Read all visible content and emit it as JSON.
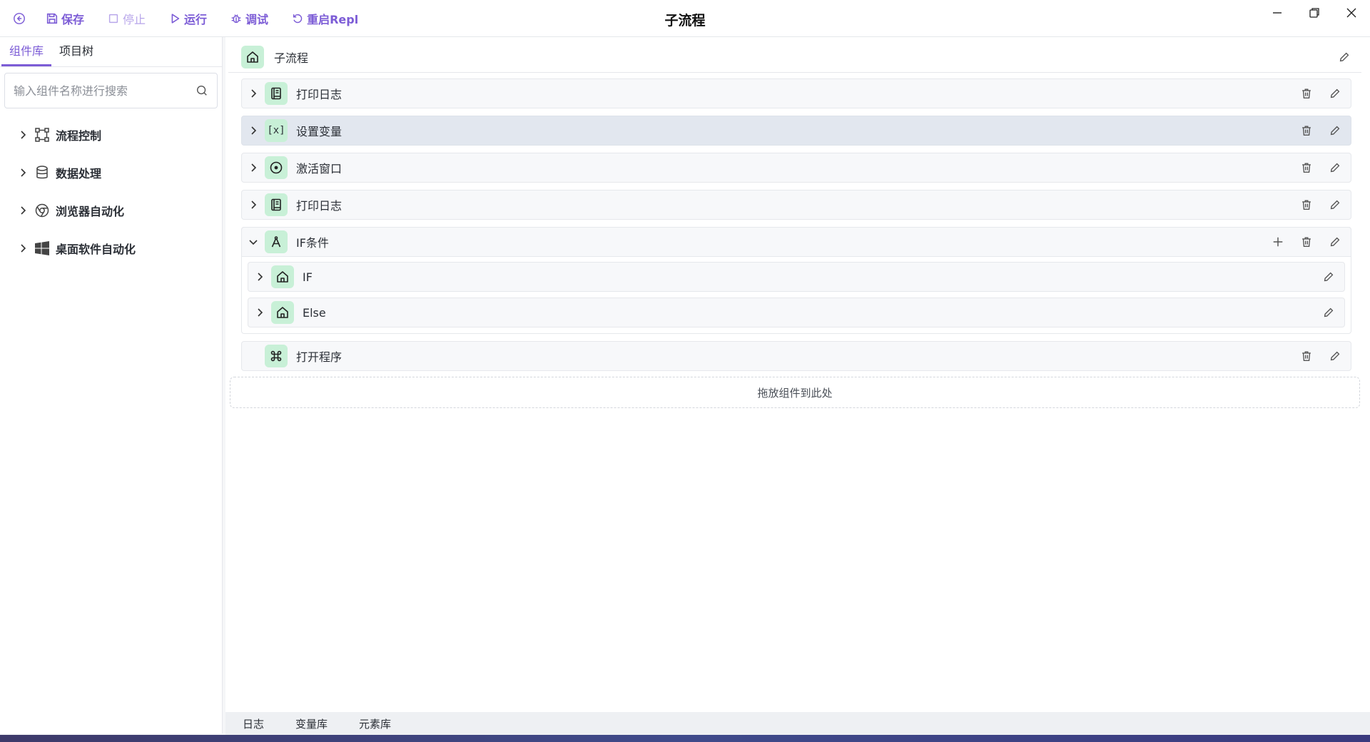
{
  "window": {
    "title": "子流程"
  },
  "toolbar": {
    "save": "保存",
    "stop": "停止",
    "run": "运行",
    "debug": "调试",
    "restart": "重启Repl"
  },
  "sidebar": {
    "tabs": [
      "组件库",
      "项目树"
    ],
    "search_placeholder": "输入组件名称进行搜索",
    "categories": [
      {
        "label": "流程控制",
        "icon": "flow-control-icon"
      },
      {
        "label": "数据处理",
        "icon": "database-icon"
      },
      {
        "label": "浏览器自动化",
        "icon": "chrome-icon"
      },
      {
        "label": "桌面软件自动化",
        "icon": "windows-icon"
      }
    ]
  },
  "flow": {
    "header_label": "子流程",
    "nodes": [
      {
        "label": "打印日志",
        "icon": "log-book-icon"
      },
      {
        "label": "设置变量",
        "icon": "variable-x-icon",
        "icon_text": "[x]"
      },
      {
        "label": "激活窗口",
        "icon": "target-circle-icon"
      },
      {
        "label": "打印日志",
        "icon": "log-book-icon"
      },
      {
        "label": "IF条件",
        "icon": "compass-icon"
      },
      {
        "label": "IF",
        "icon": "home-icon"
      },
      {
        "label": "Else",
        "icon": "home-icon"
      },
      {
        "label": "打开程序",
        "icon": "command-icon"
      }
    ],
    "drop_zone": "拖放组件到此处"
  },
  "bottom_tabs": [
    "日志",
    "变量库",
    "元素库"
  ],
  "colors": {
    "accent": "#7c5cd6",
    "icon_bg": "#c8f0d7",
    "highlight_row": "#e2e7ef"
  }
}
